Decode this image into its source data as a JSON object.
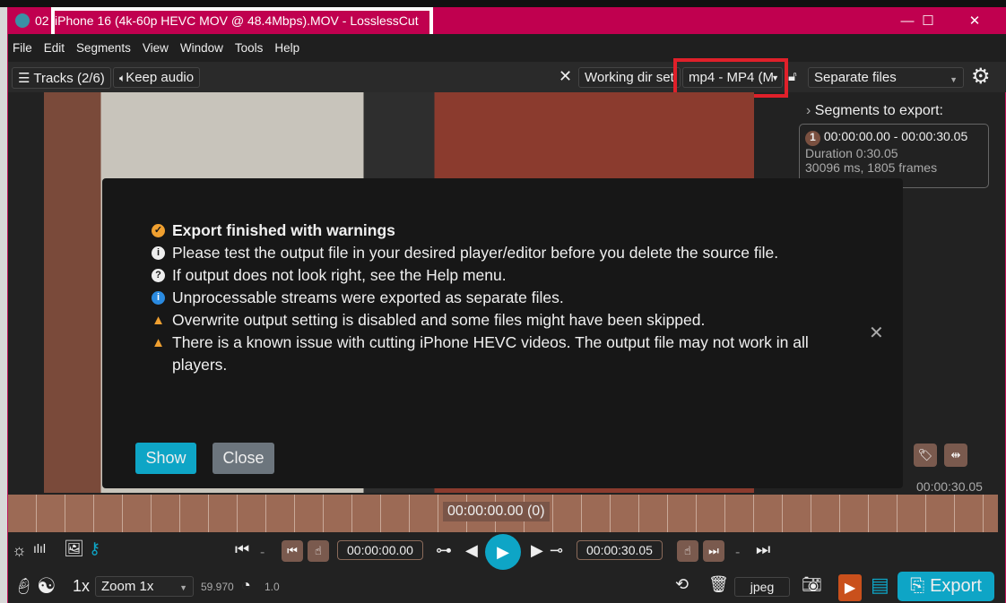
{
  "window": {
    "title_prefix": "02",
    "title": "iPhone 16 (4k-60p HEVC MOV @ 48.4Mbps).MOV - LosslessCut",
    "minimize": "—",
    "maximize": "☐",
    "close": "✕"
  },
  "menu": [
    "File",
    "Edit",
    "Segments",
    "View",
    "Window",
    "Tools",
    "Help"
  ],
  "toolbar": {
    "tracks": "Tracks (2/6)",
    "keep_audio": "Keep audio",
    "working_dir": "Working dir set",
    "format": "mp4 - MP4 (M",
    "output_mode": "Separate files"
  },
  "segments": {
    "header": "Segments to export:",
    "items": [
      {
        "index": "1",
        "range": "00:00:00.00 - 00:00:30.05",
        "duration": "Duration 0:30.05",
        "frames": "30096 ms, 1805 frames"
      }
    ],
    "end_time": "00:00:30.05"
  },
  "dialog": {
    "title": "Export finished with warnings",
    "messages": [
      "Please test the output file in your desired player/editor before you delete the source file.",
      "If output does not look right, see the Help menu.",
      "Unprocessable streams were exported as separate files.",
      "Overwrite output setting is disabled and some files might have been skipped.",
      "There is a known issue with cutting iPhone HEVC videos. The output file may not work in all players."
    ],
    "show": "Show",
    "close": "Close"
  },
  "timeline": {
    "current": "00:00:00.00 (0)"
  },
  "controls": {
    "start_time": "00:00:00.00",
    "end_time": "00:00:30.05",
    "dash": "-"
  },
  "bottom": {
    "speed": "1x",
    "zoom": "Zoom 1x",
    "fps": "59.970",
    "rate": "1.0",
    "capture_format": "jpeg",
    "export": "Export"
  },
  "colors": {
    "titlebar": "#c0004f",
    "accent": "#0ea5c6",
    "timeline": "#9c6a55"
  }
}
